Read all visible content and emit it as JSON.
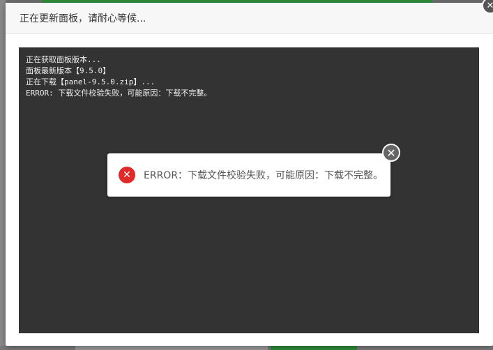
{
  "modal": {
    "title": "正在更新面板，请耐心等候...",
    "close_icon": "close-icon"
  },
  "console": {
    "lines": [
      "正在获取面板版本...",
      "面板最新版本【9.5.0】",
      "正在下载【panel-9.5.0.zip】...",
      "ERROR: 下载文件校验失败，可能原因：下载不完整。"
    ]
  },
  "toast": {
    "message": "ERROR：下载文件校验失败，可能原因：下载不完整。",
    "icon": "error-x-icon",
    "close_icon": "close-icon",
    "icon_color": "#e02a2a"
  },
  "colors": {
    "console_bg": "#333333",
    "console_text": "#f0f0f0",
    "header_bg": "#f7f7f7",
    "brand_green": "#2f8f3a"
  }
}
